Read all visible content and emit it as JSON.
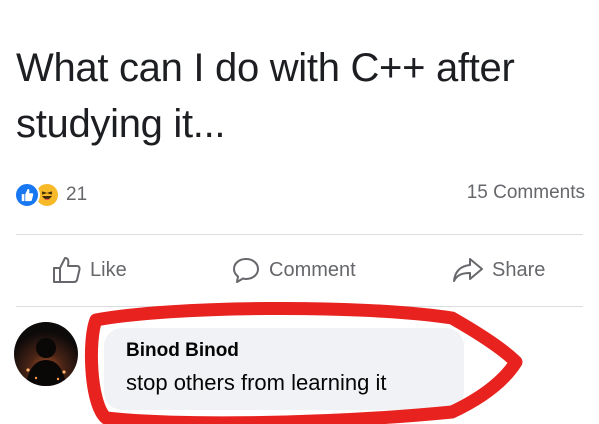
{
  "post": {
    "title": "What can I do with C++ after studying it..."
  },
  "stats": {
    "reaction_icons": [
      "like-icon",
      "haha-icon"
    ],
    "reaction_count": "21",
    "comments": "15 Comments"
  },
  "actions": {
    "like_label": "Like",
    "comment_label": "Comment",
    "share_label": "Share"
  },
  "comment": {
    "author": "Binod Binod",
    "text": "stop others from learning it"
  },
  "colors": {
    "like_blue": "#1877f2",
    "haha_yellow": "#f7b928",
    "annotation_red": "#e8231f",
    "secondary_text": "#65676b"
  }
}
